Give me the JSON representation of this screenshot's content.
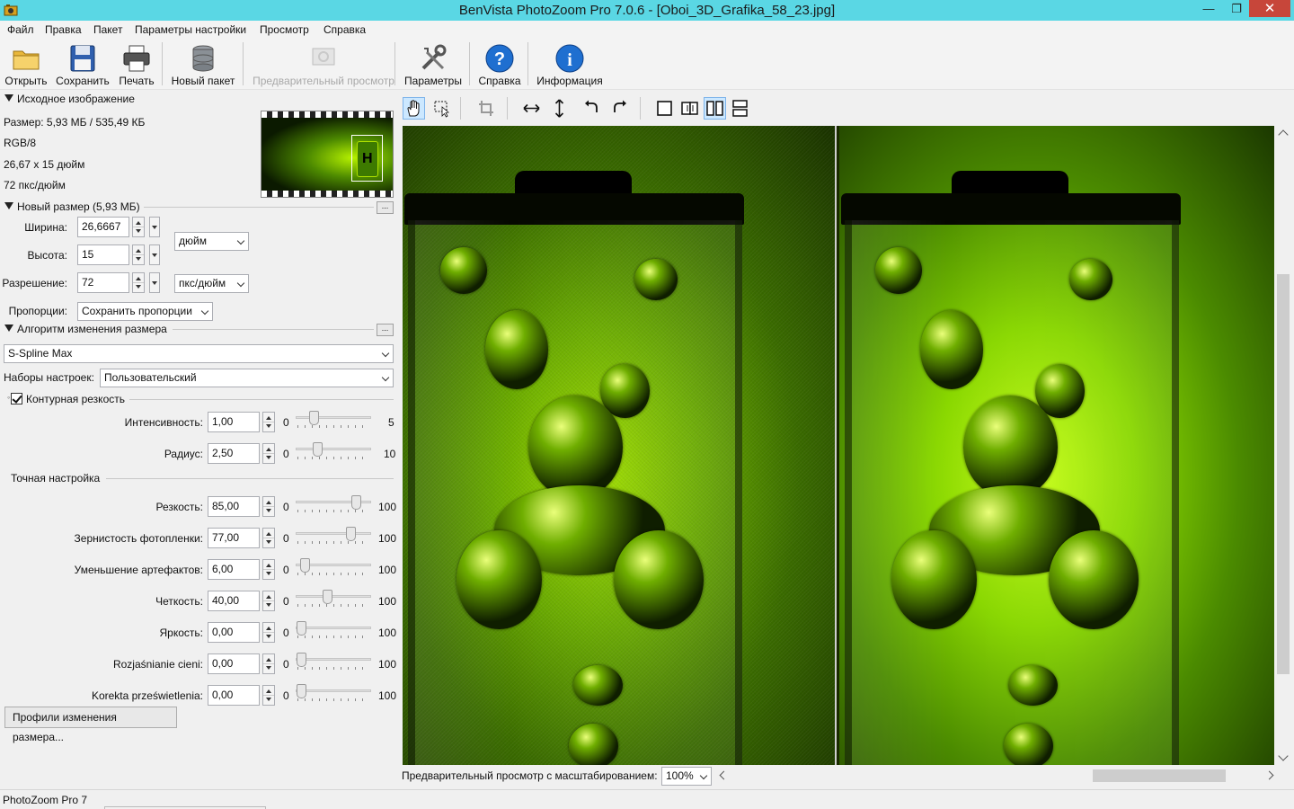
{
  "window": {
    "title": "BenVista PhotoZoom Pro 7.0.6 - [Oboi_3D_Grafika_58_23.jpg]",
    "minimize": "—",
    "restore": "❐",
    "close": "✕"
  },
  "menu": [
    "Файл",
    "Правка",
    "Пакет",
    "Параметры настройки",
    "Просмотр",
    "Справка"
  ],
  "toolbar": {
    "open": "Открыть",
    "save": "Сохранить",
    "print": "Печать",
    "new_batch": "Новый пакет",
    "preview": "Предварительный просмотр",
    "settings": "Параметры",
    "help": "Справка",
    "info": "Информация"
  },
  "source_image": {
    "header": "Исходное изображение",
    "size": "Размер: 5,93 МБ / 535,49 КБ",
    "mode": "RGB/8",
    "dimensions": "26,67 x 15 дюйм",
    "resolution": "72 пкс/дюйм"
  },
  "new_size": {
    "header": "Новый размер (5,93 МБ)",
    "more": "...",
    "width_label": "Ширина:",
    "width_value": "26,6667",
    "height_label": "Высота:",
    "height_value": "15",
    "resolution_label": "Разрешение:",
    "resolution_value": "72",
    "unit": "дюйм",
    "res_unit": "пкс/дюйм",
    "proportions_label": "Пропорции:",
    "proportions_value": "Сохранить пропорции"
  },
  "algorithm": {
    "header": "Алгоритм изменения размера",
    "more": "...",
    "method": "S-Spline Max",
    "presets_label": "Наборы настроек:",
    "presets_value": "Пользовательский",
    "unsharp_label": "Контурная резкость",
    "unsharp_checked": true,
    "intensity": {
      "label": "Интенсивность:",
      "value": "1,00",
      "min": "0",
      "max": "5",
      "pos": 0.2
    },
    "radius": {
      "label": "Радиус:",
      "value": "2,50",
      "min": "0",
      "max": "10",
      "pos": 0.25
    }
  },
  "fine_tune": {
    "header": "Точная настройка",
    "sliders": [
      {
        "label": "Резкость:",
        "value": "85,00",
        "min": "0",
        "max": "100",
        "pos": 0.85
      },
      {
        "label": "Зернистость фотопленки:",
        "value": "77,00",
        "min": "0",
        "max": "100",
        "pos": 0.77
      },
      {
        "label": "Уменьшение артефактов:",
        "value": "6,00",
        "min": "0",
        "max": "100",
        "pos": 0.06
      },
      {
        "label": "Четкость:",
        "value": "40,00",
        "min": "0",
        "max": "100",
        "pos": 0.4
      },
      {
        "label": "Яркость:",
        "value": "0,00",
        "min": "0",
        "max": "100",
        "pos": 0.0
      },
      {
        "label": "Rozjaśnianie cieni:",
        "value": "0,00",
        "min": "0",
        "max": "100",
        "pos": 0.0
      },
      {
        "label": "Korekta prześwietlenia:",
        "value": "0,00",
        "min": "0",
        "max": "100",
        "pos": 0.0
      }
    ],
    "profiles_button": "Профили изменения размера..."
  },
  "preview_footer": {
    "label": "Предварительный просмотр с масштабированием:",
    "zoom": "100%"
  },
  "status": {
    "text": "PhotoZoom Pro 7"
  }
}
